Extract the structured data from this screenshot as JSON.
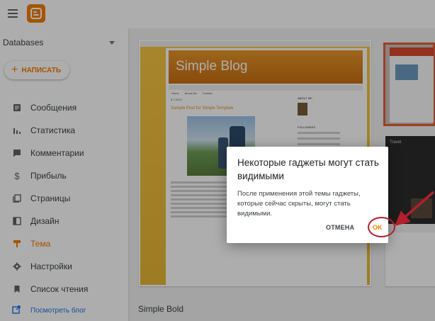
{
  "app": {
    "logo": "blogger-logo"
  },
  "sidebar": {
    "blog_selector": "Databases",
    "new_post_label": "НАПИСАТЬ",
    "items": [
      {
        "label": "Сообщения",
        "icon": "posts-icon"
      },
      {
        "label": "Статистика",
        "icon": "stats-icon"
      },
      {
        "label": "Комментарии",
        "icon": "comments-icon"
      },
      {
        "label": "Прибыль",
        "icon": "dollar-icon"
      },
      {
        "label": "Страницы",
        "icon": "pages-icon"
      },
      {
        "label": "Дизайн",
        "icon": "layout-icon"
      },
      {
        "label": "Тема",
        "icon": "theme-icon",
        "active": true
      },
      {
        "label": "Настройки",
        "icon": "gear-icon"
      },
      {
        "label": "Список чтения",
        "icon": "bookmark-icon"
      }
    ],
    "view_blog_label": "Посмотреть блог"
  },
  "preview": {
    "blog_title": "Simple Blog",
    "tabs": [
      "Home",
      "About Me",
      "Contact"
    ],
    "post_date": "8.7.2013",
    "post_title": "Sample Post for Simple Template",
    "aside_about": "ABOUT ME",
    "aside_followers": "FOLLOWERS"
  },
  "thumbs": {
    "second_title": "Travel"
  },
  "theme_name": "Simple Bold",
  "dialog": {
    "title": "Некоторые гаджеты могут стать видимыми",
    "body": "После применения этой темы гаджеты, которые сейчас скрыты, могут стать видимыми.",
    "cancel_label": "ОТМЕНА",
    "ok_label": "OK"
  },
  "colors": {
    "accent": "#f57c00",
    "annotation_red": "#b21f2d",
    "scrim": "rgba(0,0,0,0.32)"
  }
}
